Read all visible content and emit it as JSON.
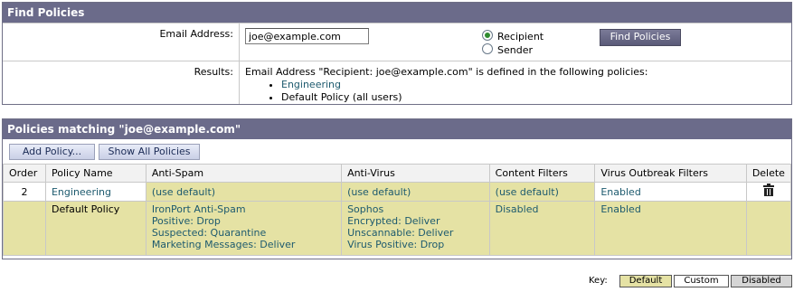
{
  "find_policies": {
    "title": "Find Policies",
    "email_label": "Email Address:",
    "email_value": "joe@example.com",
    "radio_recipient": "Recipient",
    "radio_sender": "Sender",
    "selected_radio": "Recipient",
    "find_button": "Find Policies",
    "results_label": "Results:",
    "results_text": "Email Address \"Recipient: joe@example.com\" is defined in the following policies:",
    "results_items": [
      "Engineering",
      "Default Policy (all users)"
    ]
  },
  "policies": {
    "title": "Policies matching \"joe@example.com\"",
    "add_button": "Add Policy...",
    "show_all_button": "Show All Policies",
    "columns": [
      "Order",
      "Policy Name",
      "Anti-Spam",
      "Anti-Virus",
      "Content Filters",
      "Virus Outbreak Filters",
      "Delete"
    ],
    "rows": [
      {
        "order": "2",
        "name": "Engineering",
        "anti_spam": "(use default)",
        "anti_virus": "(use default)",
        "content_filters": "(use default)",
        "virus_outbreak": "Enabled",
        "delete_icon": "trash-icon"
      },
      {
        "order": "",
        "name": "Default Policy",
        "anti_spam": [
          "IronPort Anti-Spam",
          "Positive: Drop",
          "Suspected: Quarantine",
          "Marketing Messages: Deliver"
        ],
        "anti_virus": [
          "Sophos",
          "Encrypted: Deliver",
          "Unscannable: Deliver",
          "Virus Positive: Drop"
        ],
        "content_filters": "Disabled",
        "virus_outbreak": "Enabled"
      }
    ]
  },
  "key": {
    "label": "Key:",
    "default": "Default",
    "custom": "Custom",
    "disabled": "Disabled"
  },
  "colors": {
    "header_bg": "#6b6b8a",
    "default_bg": "#e5e2a4",
    "link": "#1d5a6e"
  }
}
